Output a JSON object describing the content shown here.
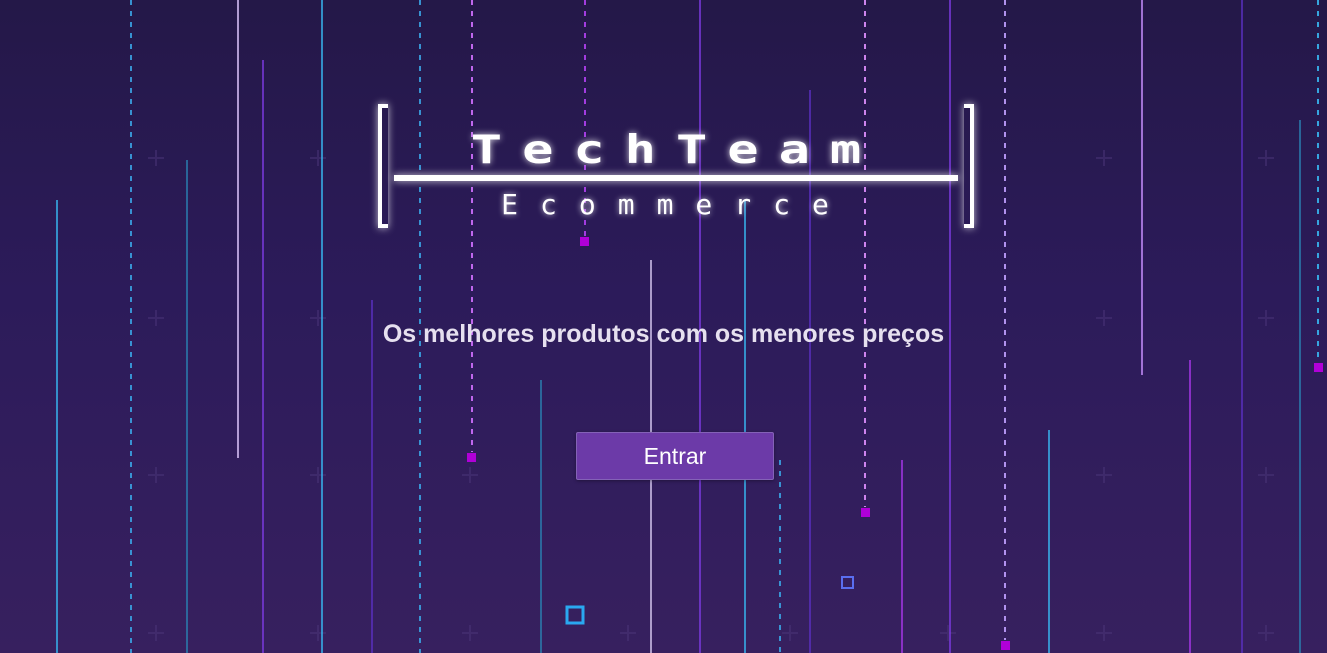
{
  "logo": {
    "title": "TechTeam",
    "subtitle": "Ecommerce"
  },
  "tagline": "Os melhores produtos com os menores preços",
  "enter_button": {
    "label": "Entrar"
  },
  "colors": {
    "background": "#2a1b56",
    "button": "#6c3aa8",
    "neon_cyan": "#38b6f0",
    "neon_purple": "#a636e8",
    "accent_magenta": "#b000d8"
  }
}
